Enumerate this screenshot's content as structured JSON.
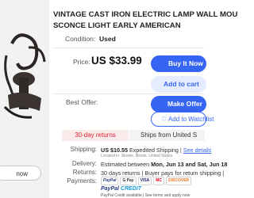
{
  "photo": {
    "now_button": "now"
  },
  "listing": {
    "title_line1": "VINTAGE CAST IRON ELECTRIC LAMP WALL MOU",
    "title_line2": "SCONCE LIGHT EARLY AMERICAN",
    "condition_label": "Condition:",
    "condition_value": "Used",
    "price_label": "Price:",
    "price_value": "US $33.99",
    "buy_button": "Buy It Now",
    "cart_button": "Add to cart",
    "best_offer_label": "Best Offer:",
    "offer_button": "Make Offer",
    "watch_button": "Add to Watchlist",
    "returns_badge": "30-day returns",
    "ships_badge": "Ships from United S"
  },
  "shipping": {
    "label": "Shipping:",
    "value": "US $10.55",
    "method": "Expedited Shipping",
    "separator": "|",
    "details_link": "See details",
    "location": "Located in: Skokie, Illinois, United States"
  },
  "delivery": {
    "label": "Delivery:",
    "prefix": "Estimated between",
    "dates": "Mon, Jun 13 and Sat, Jun 18"
  },
  "returns": {
    "label": "Returns:",
    "value": "30 days returns | Buyer pays for return shipping |"
  },
  "payments": {
    "label": "Payments:",
    "logos": [
      "PayPal",
      "G Pay",
      "VISA",
      "MC",
      "DISCOVER"
    ],
    "credit_pp": "PayPal",
    "credit_cr": "CREDIT",
    "credit_note": "PayPal Credit available | See terms and apply now"
  },
  "colors": {
    "accent": "#3665f3",
    "returns_red": "#dd1e31"
  }
}
